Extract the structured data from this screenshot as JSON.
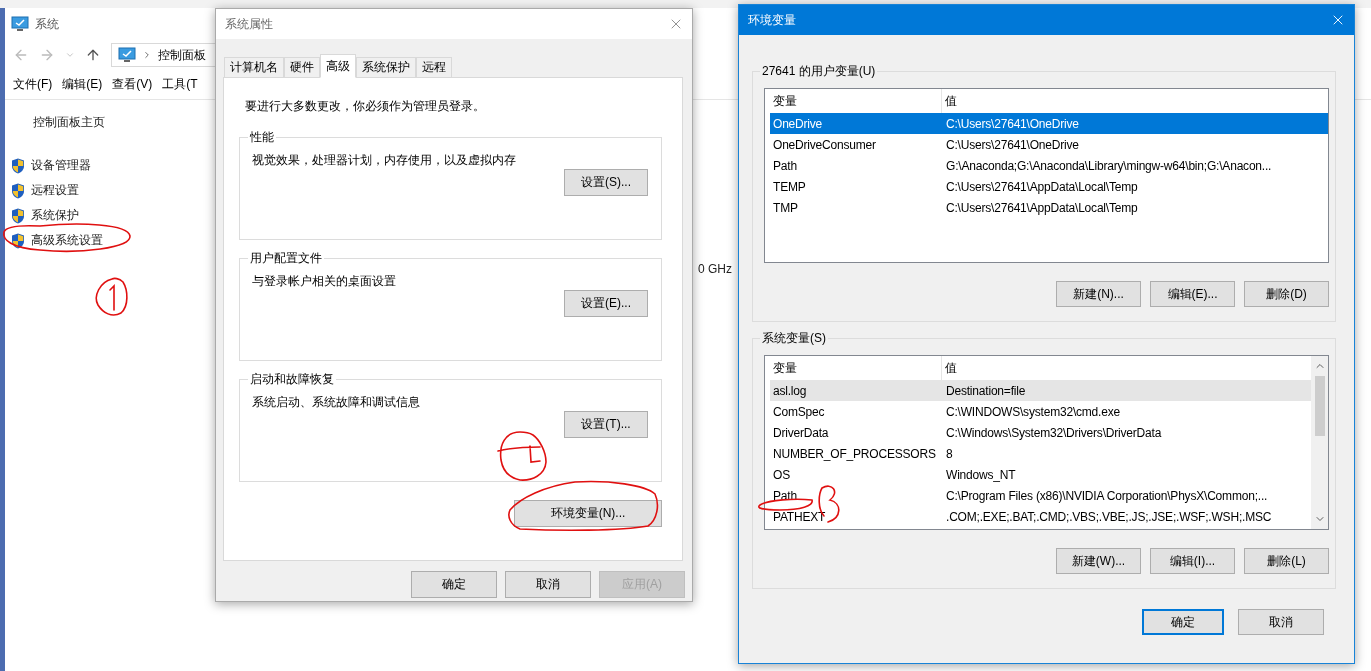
{
  "system_window": {
    "title": "系统",
    "breadcrumb": [
      "控制面板"
    ],
    "menu": [
      "文件(F)",
      "编辑(E)",
      "查看(V)",
      "工具(T"
    ],
    "sidebar": {
      "home": "控制面板主页",
      "items": [
        "设备管理器",
        "远程设置",
        "系统保护",
        "高级系统设置"
      ]
    },
    "content_text": "0 GHz"
  },
  "properties_dialog": {
    "title": "系统属性",
    "tabs": [
      {
        "label": "计算机名",
        "selected": false
      },
      {
        "label": "硬件",
        "selected": false
      },
      {
        "label": "高级",
        "selected": true
      },
      {
        "label": "系统保护",
        "selected": false
      },
      {
        "label": "远程",
        "selected": false
      }
    ],
    "notice": "要进行大多数更改，你必须作为管理员登录。",
    "groups": [
      {
        "title": "性能",
        "description": "视觉效果，处理器计划，内存使用，以及虚拟内存",
        "button": "设置(S)..."
      },
      {
        "title": "用户配置文件",
        "description": "与登录帐户相关的桌面设置",
        "button": "设置(E)..."
      },
      {
        "title": "启动和故障恢复",
        "description": "系统启动、系统故障和调试信息",
        "button": "设置(T)..."
      }
    ],
    "env_button": "环境变量(N)...",
    "buttons": [
      {
        "label": "确定",
        "disabled": false
      },
      {
        "label": "取消",
        "disabled": false
      },
      {
        "label": "应用(A)",
        "disabled": true
      }
    ]
  },
  "env_dialog": {
    "title": "环境变量",
    "sections": [
      {
        "title": "27641 的用户变量(U)",
        "focused": true,
        "columns": [
          "变量",
          "值"
        ],
        "scrollbar": false,
        "rows": [
          {
            "name": "OneDrive",
            "value": "C:\\Users\\27641\\OneDrive",
            "selected": true
          },
          {
            "name": "OneDriveConsumer",
            "value": "C:\\Users\\27641\\OneDrive",
            "selected": false
          },
          {
            "name": "Path",
            "value": "G:\\Anaconda;G:\\Anaconda\\Library\\mingw-w64\\bin;G:\\Anacon...",
            "selected": false
          },
          {
            "name": "TEMP",
            "value": "C:\\Users\\27641\\AppData\\Local\\Temp",
            "selected": false
          },
          {
            "name": "TMP",
            "value": "C:\\Users\\27641\\AppData\\Local\\Temp",
            "selected": false
          }
        ],
        "buttons": [
          "新建(N)...",
          "编辑(E)...",
          "删除(D)"
        ]
      },
      {
        "title": "系统变量(S)",
        "focused": false,
        "columns": [
          "变量",
          "值"
        ],
        "scrollbar": true,
        "rows": [
          {
            "name": "asl.log",
            "value": "Destination=file",
            "selected": true
          },
          {
            "name": "ComSpec",
            "value": "C:\\WINDOWS\\system32\\cmd.exe",
            "selected": false
          },
          {
            "name": "DriverData",
            "value": "C:\\Windows\\System32\\Drivers\\DriverData",
            "selected": false
          },
          {
            "name": "NUMBER_OF_PROCESSORS",
            "value": "8",
            "selected": false
          },
          {
            "name": "OS",
            "value": "Windows_NT",
            "selected": false
          },
          {
            "name": "Path",
            "value": "C:\\Program Files (x86)\\NVIDIA Corporation\\PhysX\\Common;...",
            "selected": false
          },
          {
            "name": "PATHEXT",
            "value": ".COM;.EXE;.BAT;.CMD;.VBS;.VBE;.JS;.JSE;.WSF;.WSH;.MSC",
            "selected": false
          }
        ],
        "buttons": [
          "新建(W)...",
          "编辑(I)...",
          "删除(L)"
        ]
      }
    ],
    "buttons": [
      {
        "label": "确定",
        "default": true
      },
      {
        "label": "取消",
        "default": false
      }
    ]
  }
}
